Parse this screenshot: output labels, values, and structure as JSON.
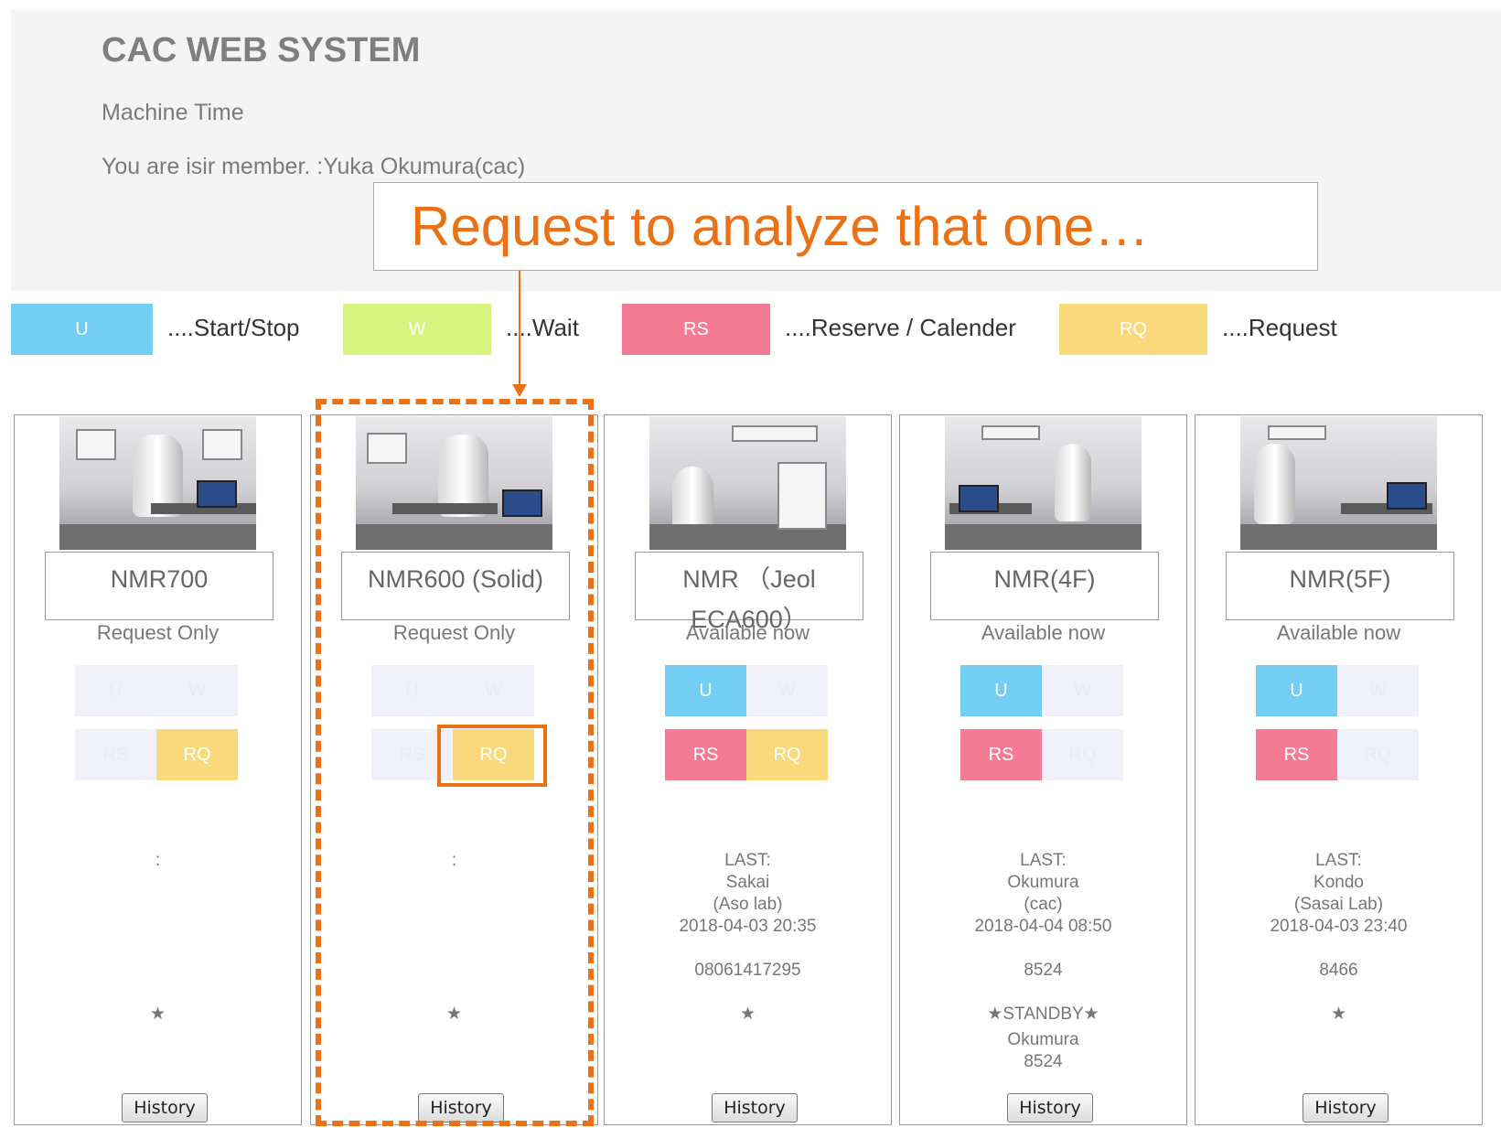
{
  "header": {
    "title": "CAC WEB SYSTEM",
    "subtitle": "Machine Time",
    "member_text": "You are isir member. :Yuka Okumura(cac)"
  },
  "annotation": {
    "callout_text": "Request to analyze that one…",
    "color": "#ec7014"
  },
  "legend": [
    {
      "swatch": "U",
      "label": "....Start/Stop",
      "color": "#74cdf3"
    },
    {
      "swatch": "W",
      "label": "....Wait",
      "color": "#d7f57e"
    },
    {
      "swatch": "RS",
      "label": "....Reserve / Calender",
      "color": "#f57b94"
    },
    {
      "swatch": "RQ",
      "label": "....Request",
      "color": "#fad97d"
    }
  ],
  "machines": [
    {
      "name": "NMR700",
      "status": "Request Only",
      "buttons": {
        "u": "U",
        "w": "W",
        "rs": "RS",
        "rq": "RQ"
      },
      "last_line": ":",
      "star": "★",
      "history": "History"
    },
    {
      "name": "NMR600 (Solid)",
      "status": "Request Only",
      "buttons": {
        "u": "U",
        "w": "W",
        "rs": "RS",
        "rq": "RQ"
      },
      "last_line": ":",
      "star": "★",
      "history": "History"
    },
    {
      "name": "NMR （Jeol ECA600）",
      "status": "Available now",
      "buttons": {
        "u": "U",
        "w": "W",
        "rs": "RS",
        "rq": "RQ"
      },
      "last_label": "LAST:",
      "last_user": "Sakai",
      "last_lab": "(Aso lab)",
      "last_time": "2018-04-03 20:35",
      "phone": "08061417295",
      "star": "★",
      "history": "History"
    },
    {
      "name": "NMR(4F)",
      "status": "Available now",
      "buttons": {
        "u": "U",
        "w": "W",
        "rs": "RS",
        "rq": "RQ"
      },
      "last_label": "LAST:",
      "last_user": "Okumura",
      "last_lab": "(cac)",
      "last_time": "2018-04-04 08:50",
      "phone": "8524",
      "star": "★STANDBY★",
      "standby_user": "Okumura",
      "standby_phone": "8524",
      "history": "History"
    },
    {
      "name": "NMR(5F)",
      "status": "Available now",
      "buttons": {
        "u": "U",
        "w": "W",
        "rs": "RS",
        "rq": "RQ"
      },
      "last_label": "LAST:",
      "last_user": "Kondo",
      "last_lab": "(Sasai Lab)",
      "last_time": "2018-04-03 23:40",
      "phone": "8466",
      "star": "★",
      "history": "History"
    }
  ]
}
